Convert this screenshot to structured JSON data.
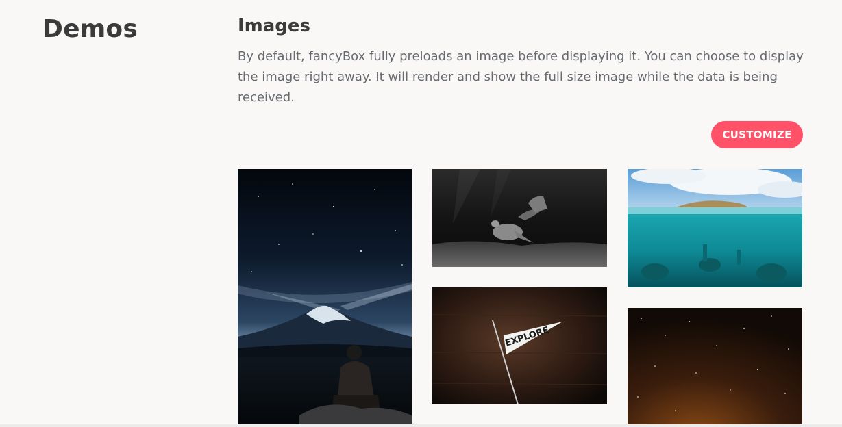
{
  "sidebar": {
    "title": "Demos"
  },
  "section": {
    "title": "Images",
    "description": "By default, fancyBox fully preloads an image before displaying it. You can choose to display the image right away. It will render and show the full size image while the data is being received."
  },
  "actions": {
    "customize_label": "CUSTOMIZE"
  },
  "gallery": {
    "images": [
      {
        "subject": "mountain-night-sky"
      },
      {
        "subject": "underwater-turtle"
      },
      {
        "subject": "explore-pennant"
      },
      {
        "subject": "ocean-island-split"
      },
      {
        "subject": "starry-dark-sky"
      }
    ],
    "explore_flag_text": "EXPLORE"
  },
  "colors": {
    "accent": "#ff5268",
    "heading": "#3b3b3b",
    "body_text": "#666a70",
    "background": "#faf8f6"
  }
}
